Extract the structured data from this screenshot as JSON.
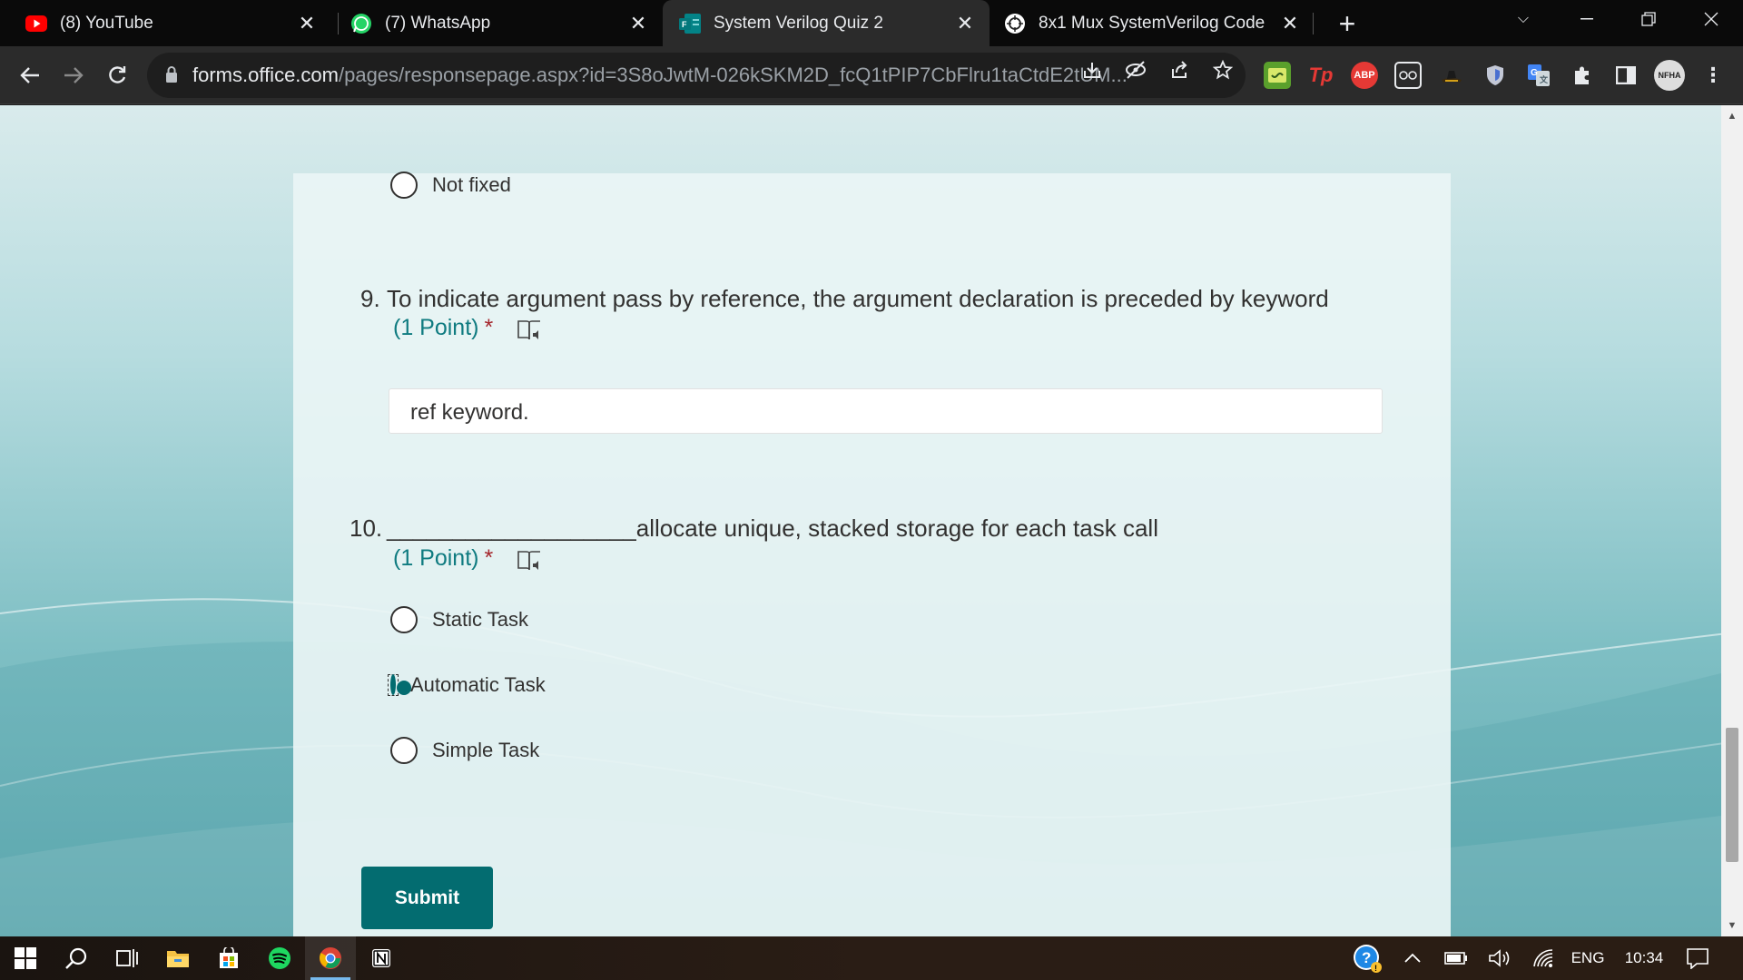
{
  "browser": {
    "tabs": [
      {
        "title": "(8) YouTube",
        "icon": "youtube-icon",
        "active": false
      },
      {
        "title": "(7) WhatsApp",
        "icon": "whatsapp-icon",
        "active": false
      },
      {
        "title": "System Verilog Quiz 2",
        "icon": "forms-icon",
        "active": true
      },
      {
        "title": "8x1 Mux SystemVerilog Code",
        "icon": "chatgpt-icon",
        "active": false
      }
    ],
    "url_host": "forms.office.com",
    "url_path": "/pages/responsepage.aspx?id=3S8oJwtM-026kSKM2D_fcQ1tPIP7CbFlru1taCtdE2tUM...",
    "extensions": [
      "notes-ext-icon",
      "tp-ext-icon",
      "adblock-plus-icon",
      "glasses-ext-icon",
      "hat-ext-icon",
      "shield-ext-icon",
      "translate-ext-icon",
      "puzzle-icon",
      "sidepanel-icon",
      "profile-avatar"
    ],
    "extension_labels": {
      "tp": "Tp",
      "abp": "ABP",
      "avatar": "NFHA"
    }
  },
  "form": {
    "prev_option": "Not fixed",
    "q9": {
      "number": "9.",
      "title": "To indicate argument pass by reference, the argument declaration is preceded by keyword",
      "points": "(1 Point)",
      "required": "*",
      "answer": "ref keyword."
    },
    "q10": {
      "number": "10.",
      "title": "___________________allocate unique, stacked storage for each task call",
      "points": "(1 Point)",
      "required": "*",
      "options": [
        {
          "label": "Static Task",
          "checked": false
        },
        {
          "label": "Automatic Task",
          "checked": true
        },
        {
          "label": "Simple Task",
          "checked": false
        }
      ]
    },
    "submit_label": "Submit",
    "accent_color": "#036c70"
  },
  "taskbar": {
    "language": "ENG",
    "time": "10:34"
  }
}
